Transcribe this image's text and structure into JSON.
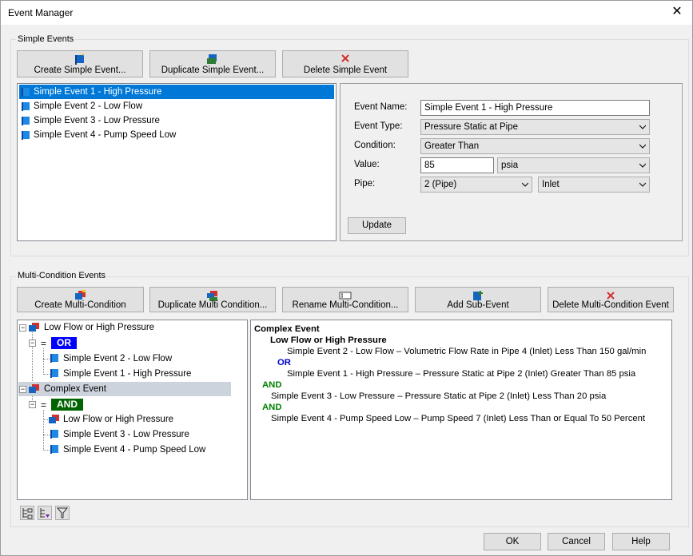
{
  "window": {
    "title": "Event Manager"
  },
  "simple_events": {
    "group_label": "Simple Events",
    "buttons": {
      "create": "Create Simple Event...",
      "duplicate": "Duplicate Simple Event...",
      "delete": "Delete Simple Event"
    },
    "items": [
      "Simple Event 1 - High Pressure",
      "Simple Event 2 - Low Flow",
      "Simple Event 3 - Low Pressure",
      "Simple Event 4 - Pump Speed Low"
    ],
    "selected_index": 0,
    "form": {
      "name_label": "Event Name:",
      "name_value": "Simple Event 1 - High Pressure",
      "type_label": "Event Type:",
      "type_value": "Pressure Static at Pipe",
      "condition_label": "Condition:",
      "condition_value": "Greater Than",
      "value_label": "Value:",
      "value_value": "85",
      "unit_value": "psia",
      "pipe_label": "Pipe:",
      "pipe_value": "2 (Pipe)",
      "location_value": "Inlet",
      "update_label": "Update"
    }
  },
  "multi_events": {
    "group_label": "Multi-Condition Events",
    "buttons": {
      "create": "Create Multi-Condition",
      "duplicate": "Duplicate Multi Condition...",
      "rename": "Rename Multi-Condition...",
      "add_sub": "Add Sub-Event",
      "delete": "Delete Multi-Condition Event"
    },
    "tree": {
      "n1": "Low Flow or High Pressure",
      "eq1": "=",
      "op1": "OR",
      "n1c1": "Simple Event 2 - Low Flow",
      "n1c2": "Simple Event 1 - High Pressure",
      "n2": "Complex Event",
      "eq2": "=",
      "op2": "AND",
      "n2c1": "Low Flow or High Pressure",
      "n2c2": "Simple Event 3 - Low Pressure",
      "n2c3": "Simple Event 4 - Pump Speed Low"
    },
    "description": {
      "title": "Complex Event",
      "sub_title": "Low Flow or High Pressure",
      "line1": "Simple Event 2 - Low Flow – Volumetric Flow Rate in Pipe 4 (Inlet) Less Than 150 gal/min",
      "or": "OR",
      "line2": "Simple Event 1 - High Pressure – Pressure Static at Pipe 2 (Inlet) Greater Than 85 psia",
      "and1": "AND",
      "line3": "Simple Event 3 - Low Pressure – Pressure Static at Pipe 2 (Inlet) Less Than 20 psia",
      "and2": "AND",
      "line4": "Simple Event 4 - Pump Speed Low – Pump Speed 7 (Inlet) Less Than or Equal To 50 Percent"
    }
  },
  "footer": {
    "ok": "OK",
    "cancel": "Cancel",
    "help": "Help"
  },
  "colors": {
    "selection": "#0078d7",
    "or_badge": "#0000ff",
    "and_badge": "#006400",
    "tree_selection": "#cdd3dc"
  },
  "icons": [
    "flag-icon",
    "flag-multi-icon",
    "delete-x-icon",
    "rename-icon",
    "add-flag-icon",
    "tree-expand-icon",
    "tree-collapse-icon",
    "tree-filter-icon"
  ]
}
